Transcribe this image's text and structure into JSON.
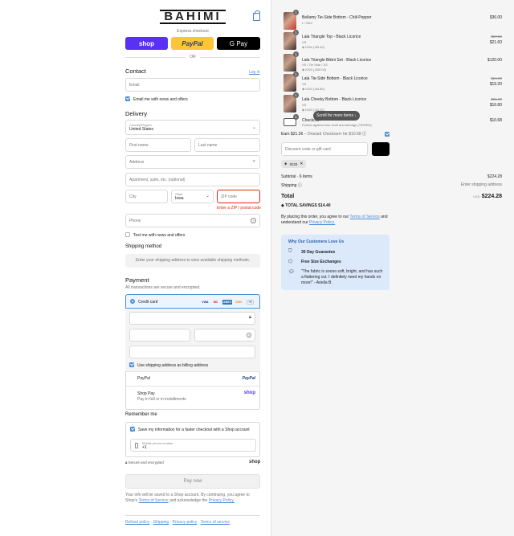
{
  "brand": {
    "logo": "BAHIMI"
  },
  "express": {
    "title": "Express checkout",
    "shop_label": "shop",
    "paypal_label": "PayPal",
    "gpay_label": "G Pay",
    "or_label": "OR"
  },
  "contact": {
    "heading": "Contact",
    "login_link": "Log in",
    "email_placeholder": "Email",
    "newsletter_label": "Email me with news and offers"
  },
  "delivery": {
    "heading": "Delivery",
    "country_label": "Country/Region",
    "country_value": "United States",
    "first_name": "First name",
    "last_name": "Last name",
    "address": "Address",
    "apartment": "Apartment, suite, etc. (optional)",
    "city": "City",
    "state_label": "State",
    "state_value": "Iowa",
    "zip": "ZIP code",
    "zip_error": "Enter a ZIP / postal code",
    "phone": "Phone",
    "text_me": "Text me with news and offers"
  },
  "shipping": {
    "heading": "Shipping method",
    "notice": "Enter your shipping address to view available shipping methods."
  },
  "payment": {
    "heading": "Payment",
    "subtext": "All transactions are secure and encrypted.",
    "credit_card": "Credit card",
    "card_brands": [
      "VISA",
      "MC",
      "AMEX",
      "DISC",
      "+5"
    ],
    "billing_label": "Use shipping address as billing address",
    "paypal": "PayPal",
    "paypal_logo": "PayPal",
    "shop_pay": "Shop Pay",
    "shop_pay_sub": "Pay in full or in installments",
    "shop_logo": "shop"
  },
  "remember": {
    "heading": "Remember me",
    "save_label": "Save my information for a faster checkout with a Shop account",
    "mobile_label": "Mobile phone number",
    "mobile_prefix": "+1",
    "secure": "Secure and encrypted",
    "shop_logo": "shop"
  },
  "pay_now": "Pay now",
  "legal": {
    "line1": "Your info will be saved to a Shop account. By continuing, you agree to Shop's",
    "tos": "Terms of Service",
    "and_ack": "and acknowledge the",
    "privacy": "Privacy Policy."
  },
  "footer_links": [
    "Refund policy",
    "Shipping",
    "Privacy policy",
    "Terms of service"
  ],
  "cart": {
    "items": [
      {
        "qty": "1",
        "name": "Bellamy Tie-Side Bottom - Chili Pepper",
        "variant": "L / Red",
        "discount": "",
        "old_price": "",
        "price": "$36.00"
      },
      {
        "qty": "1",
        "name": "Lala Triangle Top - Black Licorice",
        "variant": "XS",
        "discount": "IG20 (-$5.40)",
        "old_price": "$27.00",
        "price": "$21.60"
      },
      {
        "qty": "1",
        "name": "Lala Triangle Bikini Set - Black Licorice",
        "variant": "XS / Tie Side / XS",
        "discount": "IG20 (-$30.00)",
        "old_price": "",
        "price": "$120.00"
      },
      {
        "qty": "1",
        "name": "Lala Tie-Side Bottom - Black Licorice",
        "variant": "XS",
        "discount": "IG20 (-$4.80)",
        "old_price": "$24.00",
        "price": "$19.20"
      },
      {
        "qty": "1",
        "name": "Lala Cheeky Bottom - Black Licorice",
        "variant": "XS",
        "discount": "IG20 (-$4.20)",
        "old_price": "$21.00",
        "price": "$16.80"
      },
      {
        "qty": "1",
        "name": "Checkout+",
        "variant": "Protect against loss, theft and damage (TIERED)",
        "discount": "",
        "old_price": "",
        "price": "$10.68"
      }
    ],
    "scroll_hint": "Scroll for more items",
    "earn_label": "Earn $21.36",
    "onward_label": "– Onward Checkout+",
    "onward_for": "for $10.68",
    "discount_placeholder": "Discount code or gift card",
    "apply_label": "",
    "tag": "IG20",
    "subtotal_label": "Subtotal · 6 items",
    "subtotal_value": "$224.28",
    "shipping_label": "Shipping",
    "shipping_value": "Enter shipping address",
    "total_label": "Total",
    "currency": "USD",
    "total_value": "$224.28",
    "savings_label": "TOTAL SAVINGS",
    "savings_value": "$14.40",
    "agree_prefix": "By placing this order, you agree to our",
    "agree_tos": "Terms of Service",
    "agree_and": "and",
    "agree_understand": "understand our",
    "agree_privacy": "Privacy Policy."
  },
  "why": {
    "heading": "Why Our Customers Love Us",
    "items": [
      "30 Day Guarantee",
      "Free Size Exchanges"
    ],
    "quote": "\"The fabric is soooo soft, bright, and has such a flattering cut. I definitely need my hands on more!\" - Ariella B."
  },
  "colors": {
    "accent": "#4a8ed9",
    "shop_purple": "#5a31f4",
    "paypal_yellow": "#ffc439",
    "error": "#d82c0d"
  }
}
